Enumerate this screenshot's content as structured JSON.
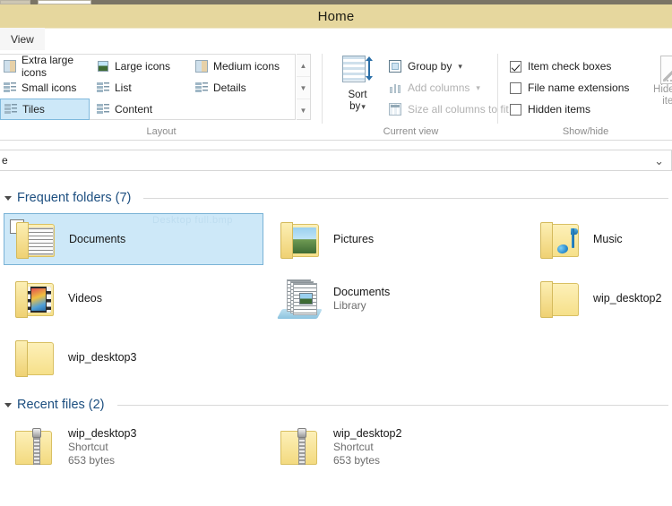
{
  "window": {
    "title": "Home"
  },
  "ribbon": {
    "tabs": [
      {
        "label": "View",
        "active": true
      }
    ],
    "groups": {
      "layout": {
        "label": "Layout",
        "items": [
          {
            "label": "Extra large icons",
            "icon": "extra-large-icons-icon",
            "selected": false
          },
          {
            "label": "Large icons",
            "icon": "large-icons-icon",
            "selected": false
          },
          {
            "label": "Medium icons",
            "icon": "medium-icons-icon",
            "selected": false
          },
          {
            "label": "Small icons",
            "icon": "small-icons-icon",
            "selected": false
          },
          {
            "label": "List",
            "icon": "list-icon",
            "selected": false
          },
          {
            "label": "Details",
            "icon": "details-icon",
            "selected": false
          },
          {
            "label": "Tiles",
            "icon": "tiles-icon",
            "selected": true
          },
          {
            "label": "Content",
            "icon": "content-icon",
            "selected": false
          }
        ],
        "scroll": {
          "up": "▲",
          "down": "▼",
          "more": "▼"
        }
      },
      "current_view": {
        "label": "Current view",
        "sort_by": {
          "label_line1": "Sort",
          "label_line2": "by",
          "caret": "▾"
        },
        "items": [
          {
            "label": "Group by",
            "caret": "▾",
            "disabled": false,
            "icon": "group-by-icon"
          },
          {
            "label": "Add columns",
            "caret": "▾",
            "disabled": true,
            "icon": "add-columns-icon"
          },
          {
            "label": "Size all columns to fit",
            "caret": "",
            "disabled": true,
            "icon": "size-columns-icon"
          }
        ]
      },
      "show_hide": {
        "label": "Show/hide",
        "checkboxes": [
          {
            "label": "Item check boxes",
            "checked": true
          },
          {
            "label": "File name extensions",
            "checked": false
          },
          {
            "label": "Hidden items",
            "checked": false
          }
        ],
        "hide_selected": {
          "line1": "Hide sele",
          "line2": "items",
          "icon": "hide-selected-items-icon"
        }
      }
    }
  },
  "address_bar": {
    "text": "e",
    "chevron": "⌄"
  },
  "content": {
    "watermark": "Desktop full.bmp",
    "sections": [
      {
        "heading": "Frequent folders (7)",
        "collapsed": false,
        "items": [
          {
            "name": "Documents",
            "sub": "",
            "icon": "folder-documents-icon",
            "selected": true,
            "checkbox": true
          },
          {
            "name": "Pictures",
            "sub": "",
            "icon": "folder-pictures-icon",
            "selected": false,
            "checkbox": false
          },
          {
            "name": "Music",
            "sub": "",
            "icon": "folder-music-icon",
            "selected": false,
            "checkbox": false
          },
          {
            "name": "Videos",
            "sub": "",
            "icon": "folder-videos-icon",
            "selected": false,
            "checkbox": false
          },
          {
            "name": "Documents",
            "sub": "Library",
            "icon": "library-documents-icon",
            "selected": false,
            "checkbox": false
          },
          {
            "name": "wip_desktop2",
            "sub": "",
            "icon": "folder-plain-icon",
            "selected": false,
            "checkbox": false
          },
          {
            "name": "wip_desktop3",
            "sub": "",
            "icon": "folder-plain-icon",
            "selected": false,
            "checkbox": false
          }
        ]
      },
      {
        "heading": "Recent files (2)",
        "collapsed": false,
        "items": [
          {
            "name": "wip_desktop3",
            "sub": "Shortcut",
            "sub2": "653 bytes",
            "icon": "zipped-folder-icon",
            "selected": false,
            "checkbox": false
          },
          {
            "name": "wip_desktop2",
            "sub": "Shortcut",
            "sub2": "653 bytes",
            "icon": "zipped-folder-icon",
            "selected": false,
            "checkbox": false
          }
        ]
      }
    ]
  },
  "colors": {
    "title_bar": "#e6d79e",
    "selection": "#cde8f8",
    "section_heading": "#1d4f80",
    "folder_yellow": "#f6e08a"
  }
}
